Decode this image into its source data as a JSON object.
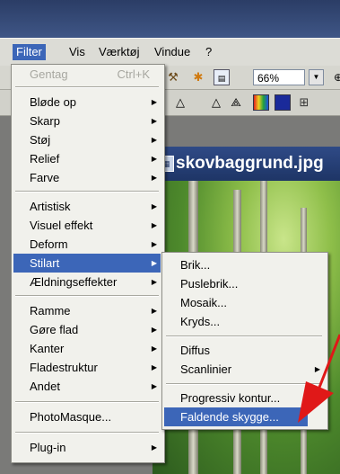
{
  "menubar": {
    "items": [
      "Filter",
      "Vis",
      "Værktøj",
      "Vindue",
      "?"
    ]
  },
  "toolbar": {
    "zoom": "66%",
    "icons": [
      "tool-icon",
      "gear-icon",
      "window-icon",
      "triangle-icon",
      "triangle-icon",
      "triangle-icon",
      "palette-icon",
      "monitor-icon",
      "grid-icon"
    ]
  },
  "document": {
    "title": "skovbaggrund.jpg"
  },
  "filter_menu": {
    "items": [
      {
        "label": "Gentag",
        "shortcut": "Ctrl+K",
        "disabled": true
      },
      {
        "label": "Bløde op",
        "submenu": true
      },
      {
        "label": "Skarp",
        "submenu": true
      },
      {
        "label": "Støj",
        "submenu": true
      },
      {
        "label": "Relief",
        "submenu": true
      },
      {
        "label": "Farve",
        "submenu": true
      },
      {
        "label": "Artistisk",
        "submenu": true
      },
      {
        "label": "Visuel effekt",
        "submenu": true
      },
      {
        "label": "Deform",
        "submenu": true
      },
      {
        "label": "Stilart",
        "submenu": true,
        "highlighted": true
      },
      {
        "label": "Ældningseffekter",
        "submenu": true
      },
      {
        "label": "Ramme",
        "submenu": true
      },
      {
        "label": "Gøre flad",
        "submenu": true
      },
      {
        "label": "Kanter",
        "submenu": true
      },
      {
        "label": "Fladestruktur",
        "submenu": true
      },
      {
        "label": "Andet",
        "submenu": true
      },
      {
        "label": "PhotoMasque..."
      },
      {
        "label": "Plug-in",
        "submenu": true
      }
    ]
  },
  "stilart_menu": {
    "items": [
      {
        "label": "Brik..."
      },
      {
        "label": "Puslebrik..."
      },
      {
        "label": "Mosaik..."
      },
      {
        "label": "Kryds..."
      },
      {
        "label": "Diffus"
      },
      {
        "label": "Scanlinier",
        "submenu": true
      },
      {
        "label": "Progressiv kontur..."
      },
      {
        "label": "Faldende skygge...",
        "highlighted": true
      }
    ]
  },
  "colors": {
    "highlight": "#3c66b8",
    "menu_bg": "#f1f1ec",
    "annotation_arrow": "#e01818"
  }
}
